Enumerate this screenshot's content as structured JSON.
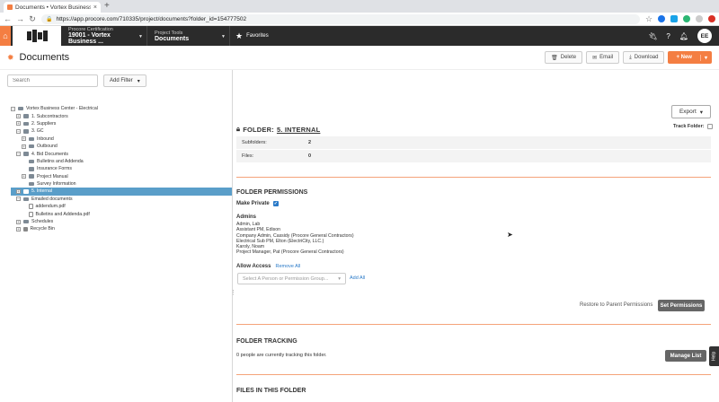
{
  "browser": {
    "tab_title": "Documents • Vortex Business",
    "url": "https://app.procore.com/710335/project/documents?folder_id=154777502"
  },
  "header": {
    "company_caption": "Procore Certification",
    "project_name": "19001 - Vortex Business ...",
    "tools_caption": "Project Tools",
    "tool_name": "Documents",
    "favorites_label": "Favorites",
    "user_initials": "EE",
    "brand_color": "#f47e42"
  },
  "page": {
    "title": "Documents",
    "delete_label": "Delete",
    "email_label": "Email",
    "download_label": "Download",
    "new_label": "+ New"
  },
  "search": {
    "placeholder": "Search",
    "add_filter_label": "Add Filter"
  },
  "tree": [
    {
      "label": "Vortex Business Center - Electrical",
      "level": 0,
      "toggle": "−",
      "icon": "folder"
    },
    {
      "label": "1. Subcontractors",
      "level": 1,
      "toggle": "+",
      "icon": "folder"
    },
    {
      "label": "2. Suppliers",
      "level": 1,
      "toggle": "+",
      "icon": "folder"
    },
    {
      "label": "3. GC",
      "level": 1,
      "toggle": "−",
      "icon": "folder"
    },
    {
      "label": "Inbound",
      "level": 2,
      "toggle": "+",
      "icon": "folder"
    },
    {
      "label": "Outbound",
      "level": 2,
      "toggle": "+",
      "icon": "folder"
    },
    {
      "label": "4. Bid Documents",
      "level": 1,
      "toggle": "−",
      "icon": "folder"
    },
    {
      "label": "Bulletins and Addenda",
      "level": 2,
      "toggle": "",
      "icon": "folder"
    },
    {
      "label": "Insurance Forms",
      "level": 2,
      "toggle": "",
      "icon": "folder"
    },
    {
      "label": "Project Manual",
      "level": 2,
      "toggle": "+",
      "icon": "folder"
    },
    {
      "label": "Survey Information",
      "level": 2,
      "toggle": "",
      "icon": "folder"
    },
    {
      "label": "5. Internal",
      "level": 1,
      "toggle": "+",
      "icon": "lock",
      "selected": true
    },
    {
      "label": "Emailed documents",
      "level": 1,
      "toggle": "−",
      "icon": "folder"
    },
    {
      "label": "addendum.pdf",
      "level": 2,
      "toggle": "",
      "icon": "file"
    },
    {
      "label": "Bulletins and Addenda.pdf",
      "level": 2,
      "toggle": "",
      "icon": "file"
    },
    {
      "label": "Schedules",
      "level": 1,
      "toggle": "+",
      "icon": "folder"
    },
    {
      "label": "Recycle Bin",
      "level": 1,
      "toggle": "+",
      "icon": "trash"
    }
  ],
  "detail": {
    "export_label": "Export",
    "folder_prefix": "FOLDER:",
    "folder_name": "5. INTERNAL",
    "track_folder_label": "Track Folder:",
    "subfolders_label": "Subfolders:",
    "subfolders_value": "2",
    "files_label": "Files:",
    "files_value": "0",
    "permissions_title": "FOLDER PERMISSIONS",
    "make_private_label": "Make Private",
    "admins_title": "Admins",
    "admins": [
      "Admin, Lab",
      "Assistant PM, Edison",
      "Company Admin, Cassidy (Procore General Contractors)",
      "Electrical Sub PM, Elton (ElectriCity, LLC.)",
      "Karoly, Noam",
      "Project Manager, Pat (Procore General Contractors)"
    ],
    "allow_access_label": "Allow Access",
    "remove_all_label": "Remove All",
    "select_placeholder": "Select A Person or Permission Group...",
    "add_all_label": "Add All",
    "restore_label": "Restore to Parent Permissions",
    "set_permissions_label": "Set Permissions",
    "tracking_title": "FOLDER TRACKING",
    "tracking_text": "0 people are currently tracking this folder.",
    "manage_list_label": "Manage List",
    "files_title": "FILES IN THIS FOLDER"
  },
  "help_label": "Help"
}
